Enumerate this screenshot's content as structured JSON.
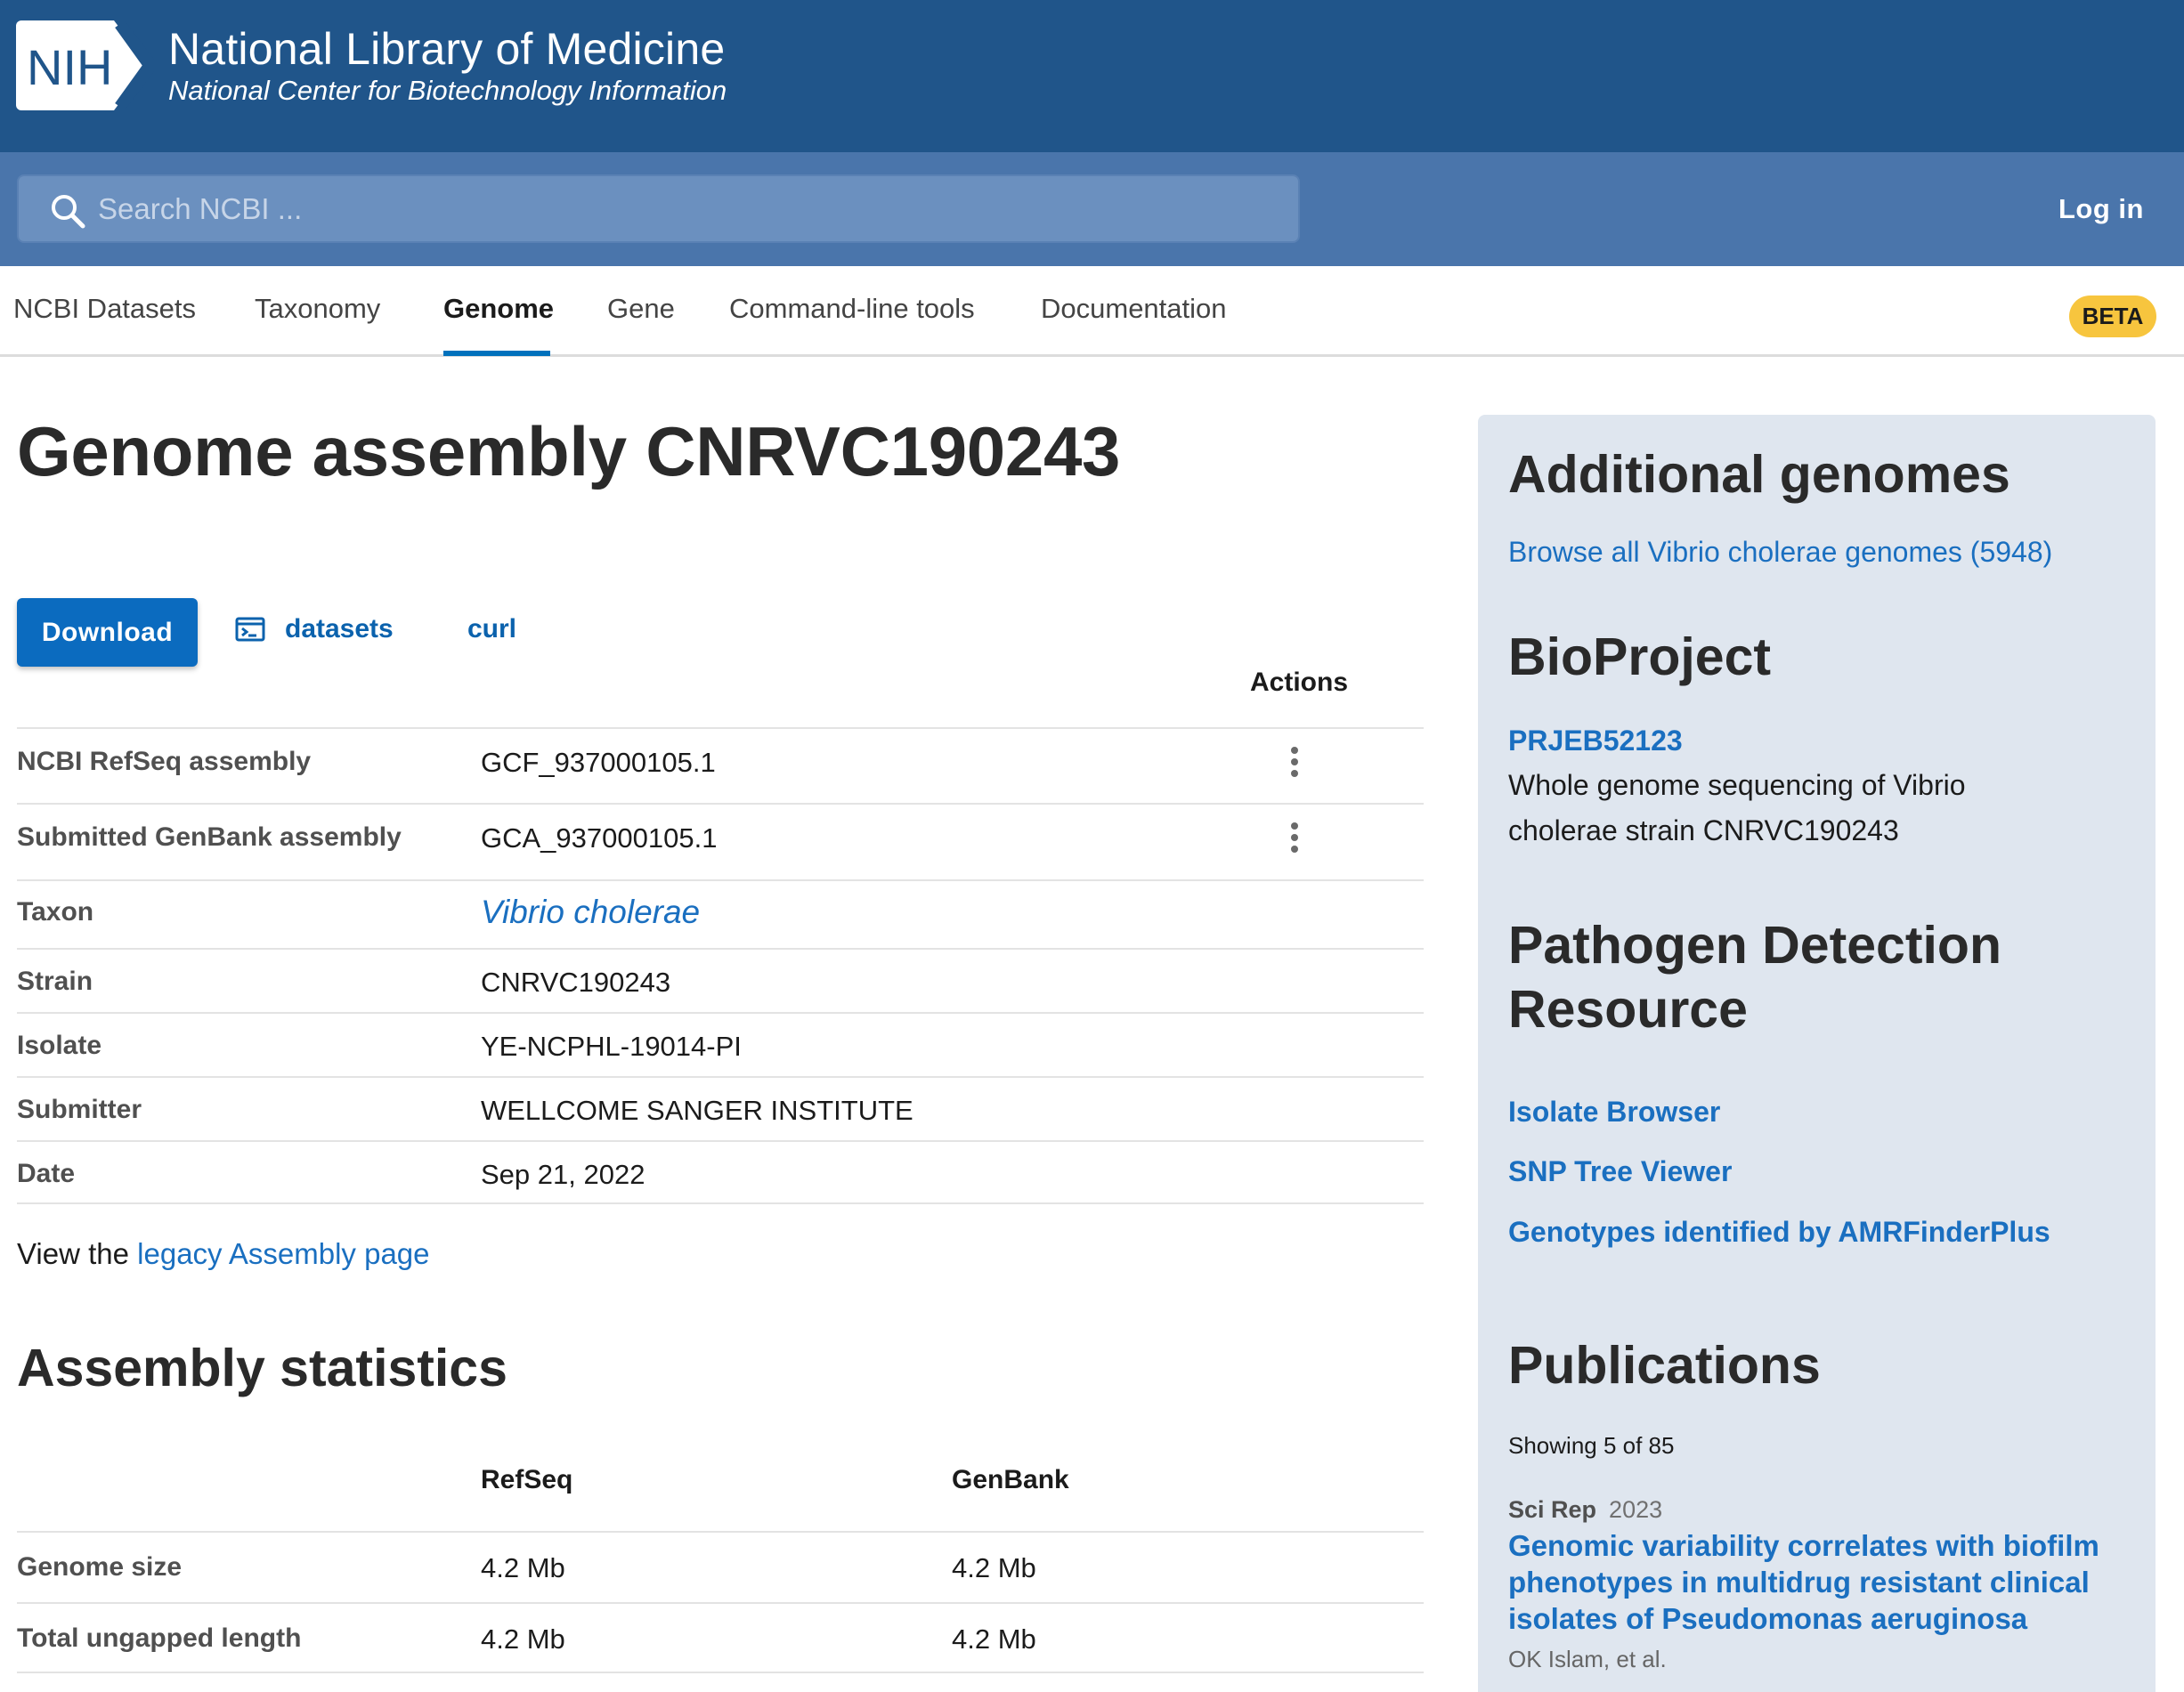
{
  "header": {
    "logo_text": "NIH",
    "title": "National Library of Medicine",
    "subtitle": "National Center for Biotechnology Information"
  },
  "search": {
    "placeholder": "Search NCBI ...",
    "login_label": "Log in"
  },
  "nav": {
    "tabs": [
      {
        "label": "NCBI Datasets",
        "active": false
      },
      {
        "label": "Taxonomy",
        "active": false
      },
      {
        "label": "Genome",
        "active": true
      },
      {
        "label": "Gene",
        "active": false
      },
      {
        "label": "Command-line tools",
        "active": false
      },
      {
        "label": "Documentation",
        "active": false
      }
    ],
    "badge": "BETA"
  },
  "main": {
    "title": "Genome assembly CNRVC190243",
    "download_label": "Download",
    "datasets_label": "datasets",
    "curl_label": "curl",
    "actions_label": "Actions",
    "rows": [
      {
        "label": "NCBI RefSeq assembly",
        "value": "GCF_937000105.1",
        "has_menu": true
      },
      {
        "label": "Submitted GenBank assembly",
        "value": "GCA_937000105.1",
        "has_menu": true
      },
      {
        "label": "Taxon",
        "value": "Vibrio cholerae",
        "link": true
      },
      {
        "label": "Strain",
        "value": "CNRVC190243"
      },
      {
        "label": "Isolate",
        "value": "YE-NCPHL-19014-PI"
      },
      {
        "label": "Submitter",
        "value": "WELLCOME SANGER INSTITUTE"
      },
      {
        "label": "Date",
        "value": "Sep 21, 2022"
      }
    ],
    "legacy_prefix": "View the",
    "legacy_link": "legacy Assembly page"
  },
  "stats": {
    "title": "Assembly statistics",
    "col_refseq": "RefSeq",
    "col_genbank": "GenBank",
    "rows": [
      {
        "label": "Genome size",
        "refseq": "4.2 Mb",
        "genbank": "4.2 Mb"
      },
      {
        "label": "Total ungapped length",
        "refseq": "4.2 Mb",
        "genbank": "4.2 Mb"
      }
    ]
  },
  "sidebar": {
    "additional_title": "Additional genomes",
    "browse_link": "Browse all Vibrio cholerae genomes (5948)",
    "bioproject_title": "BioProject",
    "bioproject_id": "PRJEB52123",
    "bioproject_desc": "Whole genome sequencing of Vibrio cholerae strain CNRVC190243",
    "pathogen_title_line1": "Pathogen Detection",
    "pathogen_title_line2": "Resource",
    "pathogen_links": [
      "Isolate Browser",
      "SNP Tree Viewer",
      "Genotypes identified by AMRFinderPlus"
    ],
    "publications_title": "Publications",
    "showing": "Showing 5 of 85",
    "publication": {
      "journal": "Sci Rep",
      "year": "2023",
      "title": "Genomic variability correlates with biofilm phenotypes in multidrug resistant clinical isolates of Pseudomonas aeruginosa",
      "authors": "OK Islam, et al."
    }
  },
  "colors": {
    "banner": "#20558a",
    "search_band": "#4a75ab",
    "primary_button": "#0b6bbf",
    "link": "#1a6fc0",
    "beta_badge": "#f7c53e",
    "sidebar_bg": "#dfe6ef"
  }
}
